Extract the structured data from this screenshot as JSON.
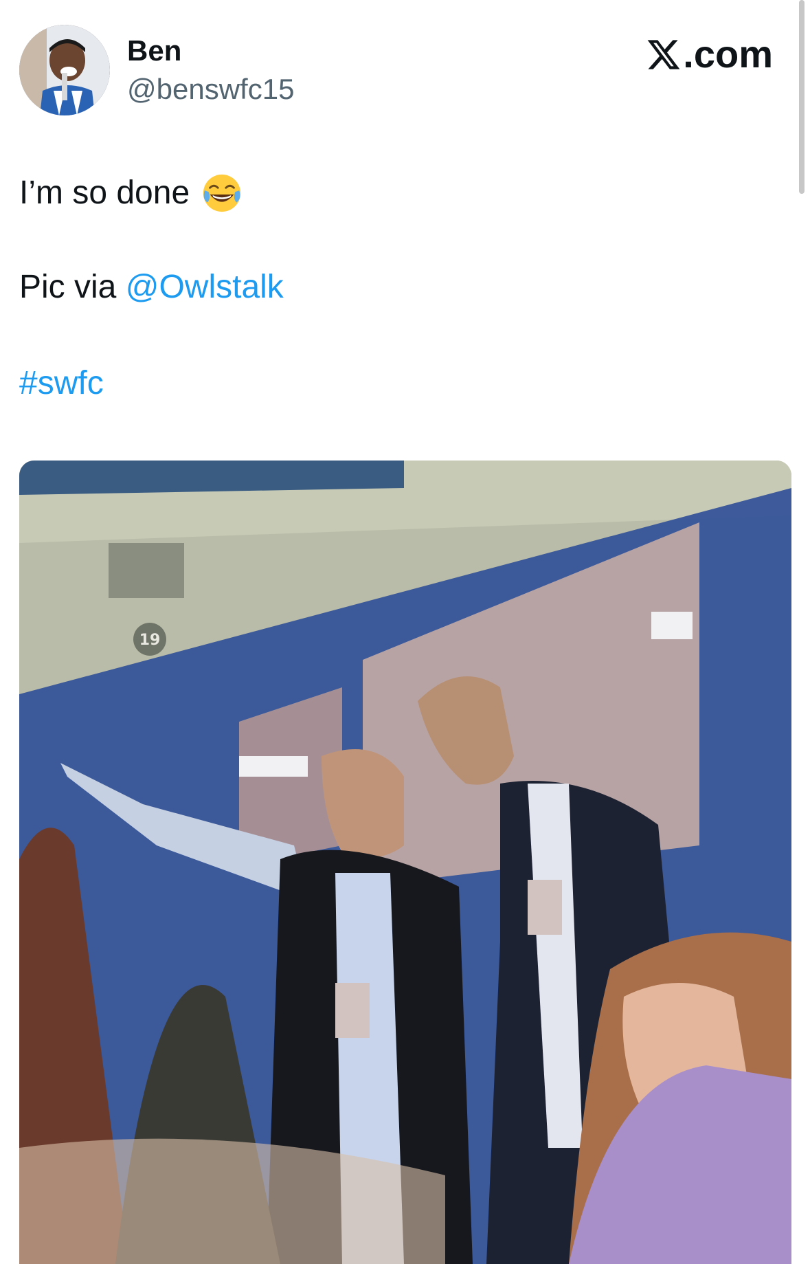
{
  "header": {
    "display_name": "Ben",
    "handle": "@benswfc15",
    "brand": ".com",
    "brand_icon": "x-logo-icon"
  },
  "tweet": {
    "line1": "I’m so done",
    "emoji": "face-with-tears-of-joy",
    "line2_prefix": "Pic via ",
    "mention": "@Owlstalk",
    "hashtag": "#swfc"
  },
  "photo": {
    "seat_number": "19"
  },
  "colors": {
    "link": "#1d9bf0",
    "text": "#0f1419",
    "secondary": "#536471"
  }
}
